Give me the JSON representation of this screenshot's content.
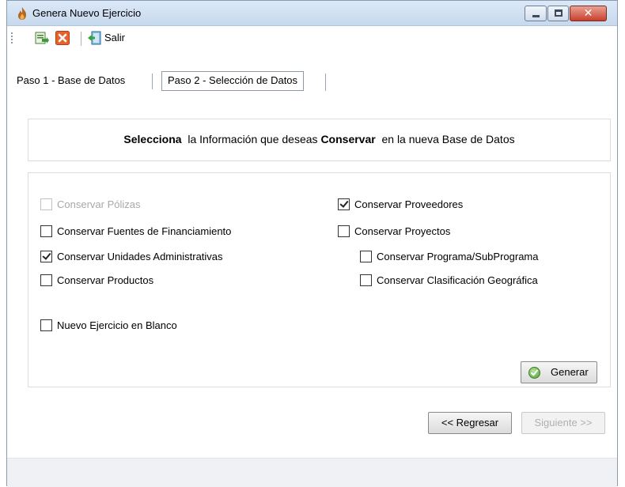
{
  "window": {
    "title": "Genera Nuevo Ejercicio"
  },
  "toolbar": {
    "icons": [
      "export-icon",
      "cancel-x-icon",
      "exit-door-icon"
    ],
    "exit_label": "Salir"
  },
  "tabs": [
    {
      "label": "Paso 1 - Base de Datos",
      "selected": false
    },
    {
      "label": "Paso 2 - Selección de Datos",
      "selected": true
    }
  ],
  "banner": {
    "bold1": "Selecciona",
    "text1": "la Información que deseas",
    "bold2": "Conservar",
    "text2": "en la nueva Base de Datos"
  },
  "options": {
    "polizas": {
      "label": "Conservar Pólizas",
      "checked": false,
      "enabled": false
    },
    "fuentes": {
      "label": "Conservar Fuentes de Financiamiento",
      "checked": false,
      "enabled": true
    },
    "unidades": {
      "label": "Conservar Unidades Administrativas",
      "checked": true,
      "enabled": true
    },
    "productos": {
      "label": "Conservar Productos",
      "checked": false,
      "enabled": true
    },
    "proveedores": {
      "label": "Conservar Proveedores",
      "checked": true,
      "enabled": true
    },
    "proyectos": {
      "label": "Conservar Proyectos",
      "checked": false,
      "enabled": true
    },
    "programa": {
      "label": "Conservar Programa/SubPrograma",
      "checked": false,
      "enabled": true
    },
    "clasificacion": {
      "label": "Conservar Clasificación Geográfica",
      "checked": false,
      "enabled": true
    },
    "nuevo_blanco": {
      "label": "Nuevo Ejercicio en Blanco",
      "checked": false,
      "enabled": true
    }
  },
  "buttons": {
    "generar": "Generar",
    "regresar": "<< Regresar",
    "siguiente": "Siguiente >>",
    "siguiente_enabled": false
  },
  "colors": {
    "titlebar": "#c7d9ee",
    "close_button": "#c9402c",
    "disabled_text": "#a8a8a8"
  }
}
